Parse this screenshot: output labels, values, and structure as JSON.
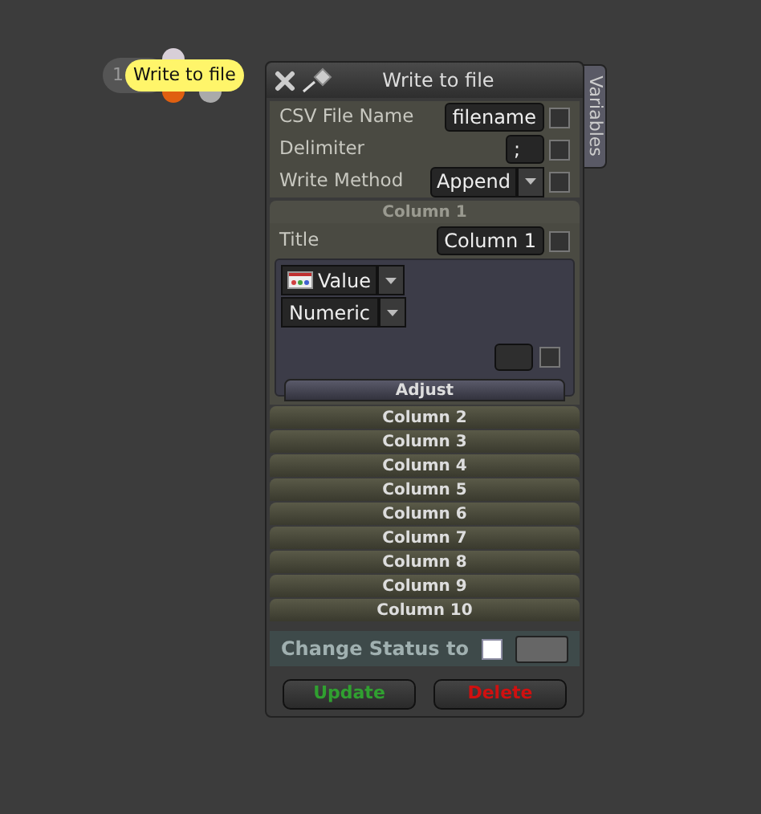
{
  "node": {
    "number": "1",
    "label": "Write to file"
  },
  "panel": {
    "title": "Write to file",
    "side_tab": "Variables",
    "fields": [
      {
        "kind": "text",
        "label": "CSV File Name",
        "value": "filename",
        "checked": false
      },
      {
        "kind": "text",
        "label": "Delimiter",
        "value": ";",
        "checked": false
      },
      {
        "kind": "dropdown",
        "label": "Write Method",
        "value": "Append",
        "checked": false
      }
    ],
    "columns": [
      {
        "title": "Column 1",
        "expanded": true,
        "field_label": "Title",
        "field_value": "Column 1",
        "field_checked": false,
        "source": "Value",
        "type": "Numeric",
        "extra_checked": false,
        "adjust": "Adjust"
      },
      {
        "title": "Column 2",
        "expanded": false
      },
      {
        "title": "Column 3",
        "expanded": false
      },
      {
        "title": "Column 4",
        "expanded": false
      },
      {
        "title": "Column 5",
        "expanded": false
      },
      {
        "title": "Column 6",
        "expanded": false
      },
      {
        "title": "Column 7",
        "expanded": false
      },
      {
        "title": "Column 8",
        "expanded": false
      },
      {
        "title": "Column 9",
        "expanded": false
      },
      {
        "title": "Column 10",
        "expanded": false
      }
    ],
    "status": {
      "label": "Change Status to",
      "checked": false
    },
    "buttons": [
      {
        "kind": "update",
        "label": "Update"
      },
      {
        "kind": "delete",
        "label": "Delete"
      }
    ]
  }
}
